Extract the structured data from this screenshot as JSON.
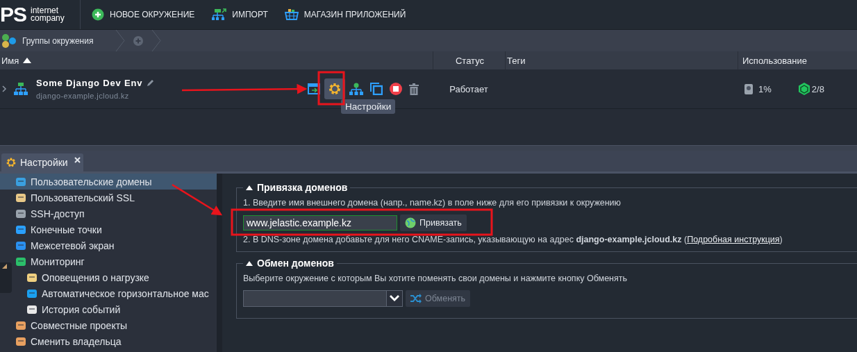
{
  "toolbar": {
    "logo": {
      "mark": "PS",
      "line1": "internet",
      "line2": "company"
    },
    "buttons": [
      {
        "label": "НОВОЕ ОКРУЖЕНИЕ",
        "kind": "new"
      },
      {
        "label": "ИМПОРТ",
        "kind": "import"
      },
      {
        "label": "МАГАЗИН ПРИЛОЖЕНИЙ",
        "kind": "store"
      }
    ]
  },
  "breadcrumb": {
    "label": "Группы окружения"
  },
  "table": {
    "columns": [
      {
        "label": "Имя",
        "sorted": true
      },
      {
        "label": "Статус",
        "sorted": false
      },
      {
        "label": "Теги",
        "sorted": false
      },
      {
        "label": "Использование",
        "sorted": false
      }
    ],
    "rows": [
      {
        "name": "Some Django Dev Env",
        "domain": "django-example.jcloud.kz",
        "expanded": false,
        "status": "Работает",
        "disk": "1%",
        "cloudlets": "2/8"
      }
    ]
  },
  "tooltip": "Настройки",
  "panel_tab": {
    "label": "Настройки"
  },
  "sidebar": {
    "items": [
      {
        "label": "Пользовательские домены",
        "kind": "domains",
        "selected": true
      },
      {
        "label": "Пользовательский SSL",
        "kind": "ssl",
        "selected": false
      },
      {
        "label": "SSH-доступ",
        "kind": "ssh",
        "selected": false
      },
      {
        "label": "Конечные точки",
        "kind": "endpoints",
        "selected": false
      },
      {
        "label": "Межсетевой экран",
        "kind": "firewall",
        "selected": false
      },
      {
        "label": "Мониторинг",
        "kind": "monitoring",
        "selected": false,
        "children": [
          {
            "label": "Оповещения о нагрузке",
            "kind": "alerts",
            "selected": false
          },
          {
            "label": "Автоматическое горизонтальное мас",
            "kind": "scaling",
            "selected": false
          },
          {
            "label": "История событий",
            "kind": "history",
            "selected": false
          }
        ]
      },
      {
        "label": "Совместные проекты",
        "kind": "collab",
        "selected": false
      },
      {
        "label": "Сменить владельца",
        "kind": "owner",
        "selected": false
      }
    ]
  },
  "bind": {
    "title": "Привязка доменов",
    "step1": "1. Введите имя внешнего домена (напр., name.kz) в поле ниже для его привязки к окружению",
    "value": "www.jelastic.example.kz",
    "button": "Привязать",
    "step2": "2. В DNS-зоне домена добавьте для него CNAME-запись, указывающую на адрес **django-example.jcloud.kz** (",
    "link": "Подробная инструкция",
    "after": ")"
  },
  "swap": {
    "title": "Обмен доменов",
    "text": "Выберите окружение с которым Вы хотите поменять свои домены и нажмите кнопку Обменять",
    "button": "Обменять",
    "disabled": true
  }
}
